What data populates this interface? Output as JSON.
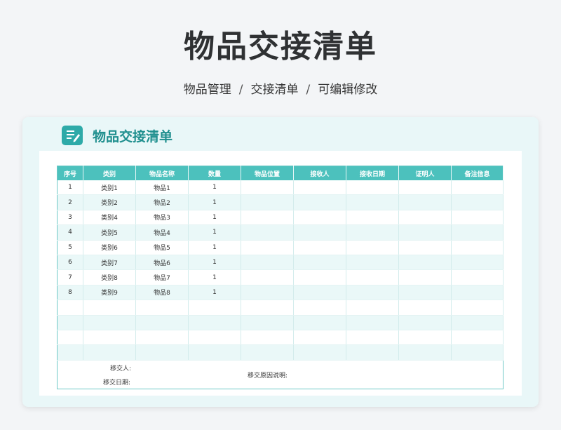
{
  "page": {
    "title": "物品交接清单",
    "breadcrumb": [
      "物品管理",
      "交接清单",
      "可编辑修改"
    ],
    "breadcrumb_sep": "/"
  },
  "card": {
    "icon": "document-edit-icon",
    "title": "物品交接清单"
  },
  "colors": {
    "accent": "#4cc1bd",
    "accent_dark": "#1f8f8e",
    "row_alt": "#eaf8f8",
    "card_bg": "#e9f7f8"
  },
  "table": {
    "headers": [
      "序号",
      "类别",
      "物品名称",
      "数量",
      "物品位置",
      "接收人",
      "接收日期",
      "证明人",
      "备注信息"
    ],
    "rows": [
      [
        "1",
        "类别1",
        "物品1",
        "1",
        "",
        "",
        "",
        "",
        ""
      ],
      [
        "2",
        "类别2",
        "物品2",
        "1",
        "",
        "",
        "",
        "",
        ""
      ],
      [
        "3",
        "类别4",
        "物品3",
        "1",
        "",
        "",
        "",
        "",
        ""
      ],
      [
        "4",
        "类别5",
        "物品4",
        "1",
        "",
        "",
        "",
        "",
        ""
      ],
      [
        "5",
        "类别6",
        "物品5",
        "1",
        "",
        "",
        "",
        "",
        ""
      ],
      [
        "6",
        "类别7",
        "物品6",
        "1",
        "",
        "",
        "",
        "",
        ""
      ],
      [
        "7",
        "类别8",
        "物品7",
        "1",
        "",
        "",
        "",
        "",
        ""
      ],
      [
        "8",
        "类别9",
        "物品8",
        "1",
        "",
        "",
        "",
        "",
        ""
      ],
      [
        "",
        "",
        "",
        "",
        "",
        "",
        "",
        "",
        ""
      ],
      [
        "",
        "",
        "",
        "",
        "",
        "",
        "",
        "",
        ""
      ],
      [
        "",
        "",
        "",
        "",
        "",
        "",
        "",
        "",
        ""
      ],
      [
        "",
        "",
        "",
        "",
        "",
        "",
        "",
        "",
        ""
      ]
    ]
  },
  "footer": {
    "handover_person": "移交人:",
    "handover_date": "移交日期:",
    "handover_reason": "移交原因说明:"
  }
}
